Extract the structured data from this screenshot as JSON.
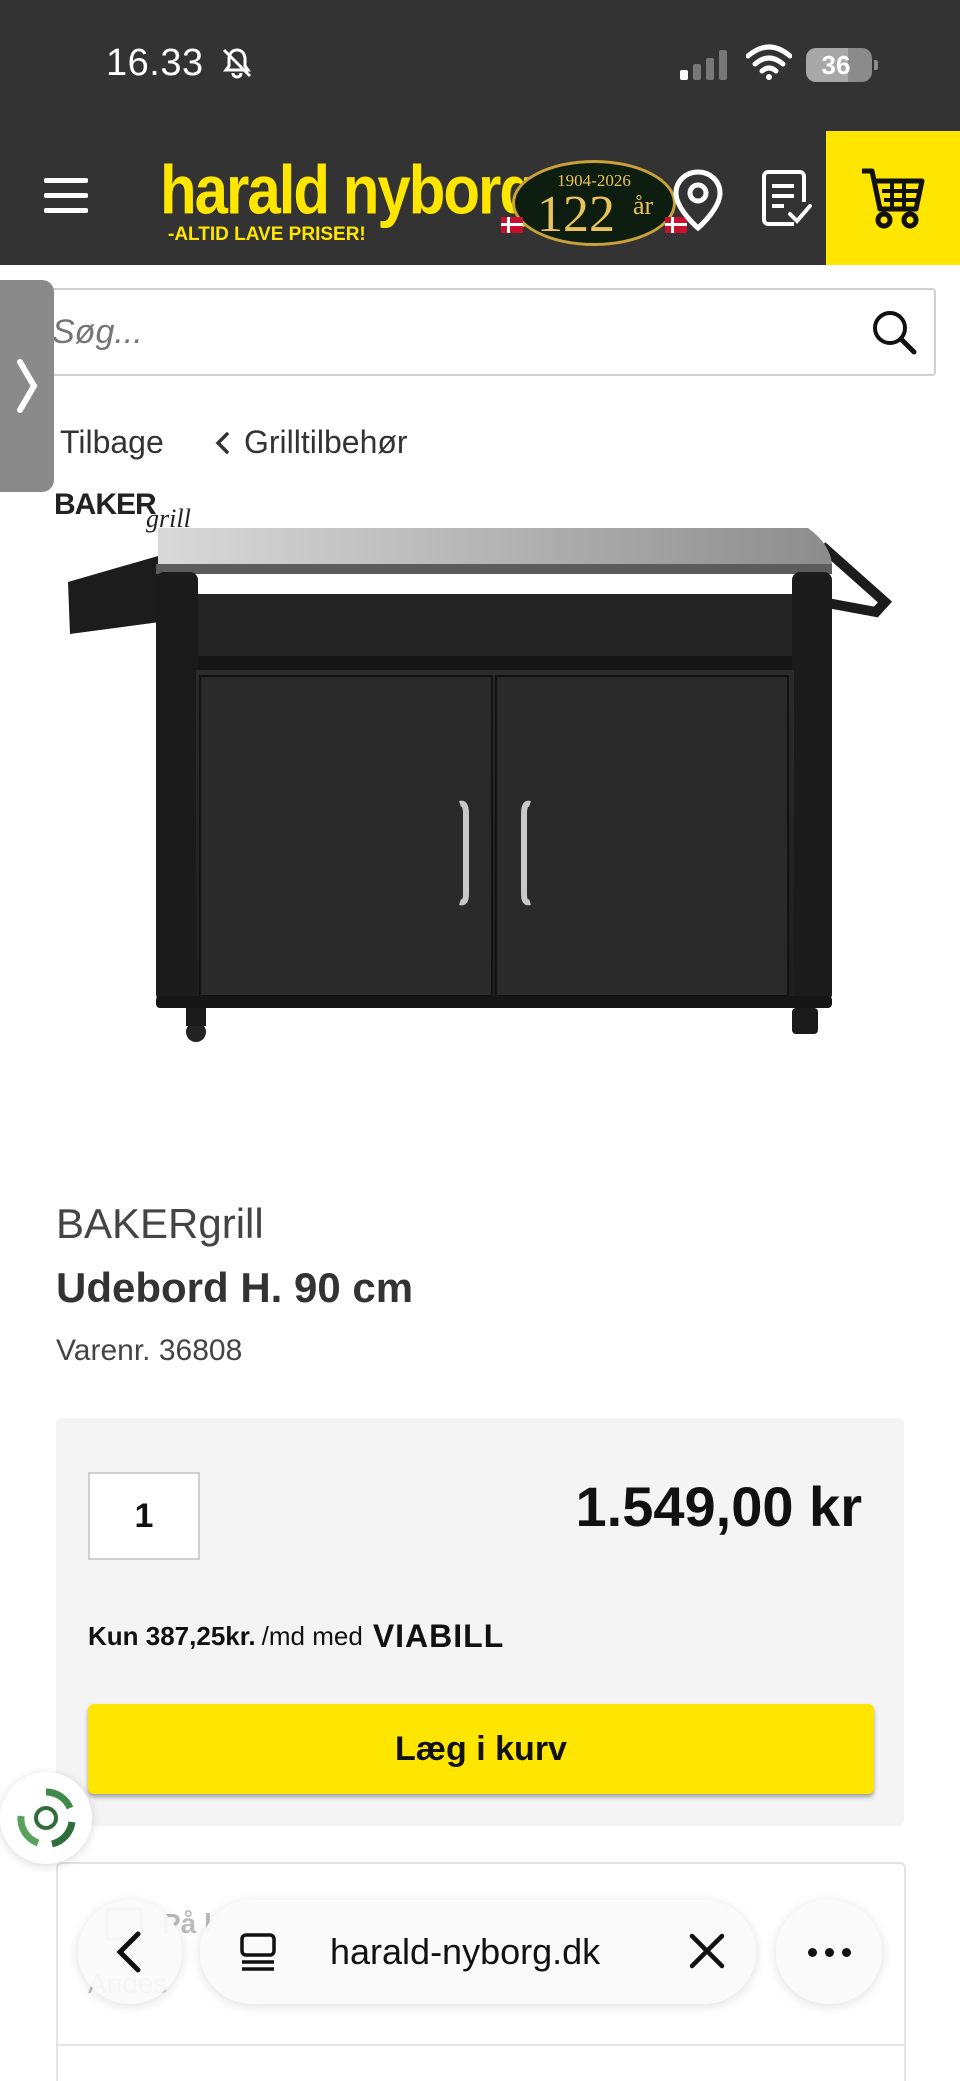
{
  "status_bar": {
    "time": "16.33",
    "battery": "36"
  },
  "header": {
    "logo_name": "harald nyborg",
    "logo_tagline": "-ALTID LAVE PRISER!",
    "anniversary_years": "1904-2026",
    "anniversary_number": "122",
    "anniversary_suffix": "år",
    "colors": {
      "header_bg": "#333333",
      "brand_yellow": "#ffe600"
    }
  },
  "search": {
    "placeholder": "Søg..."
  },
  "breadcrumb": {
    "back_label": "Tilbage",
    "category_label": "Grilltilbehør"
  },
  "product": {
    "image_brand_badge": "BAKER",
    "image_brand_script": "grill",
    "brand": "BAKERgrill",
    "title": "Udebord H. 90 cm",
    "sku": "Varenr. 36808",
    "quantity": "1",
    "price": "1.549,00 kr",
    "financing_amount": "Kun 387,25kr.",
    "financing_text": "/md med",
    "financing_provider": "VIABILL",
    "add_to_cart_label": "Læg i kurv"
  },
  "delivery": {
    "title": "På l",
    "subtitle": "Andes"
  },
  "browser": {
    "url": "harald-nyborg.dk"
  }
}
